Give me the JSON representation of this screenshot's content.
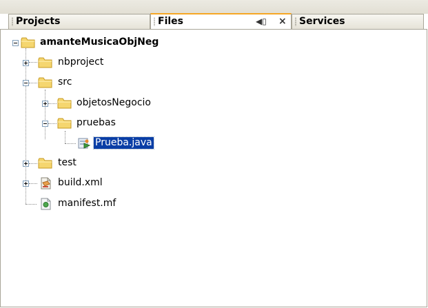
{
  "tabs": [
    {
      "label": "Projects",
      "active": false
    },
    {
      "label": "Files",
      "active": true
    },
    {
      "label": "Services",
      "active": false
    }
  ],
  "tab_controls": {
    "minimize_glyph": "◀▯",
    "close_glyph": "×"
  },
  "tree": {
    "root": {
      "label": "amanteMusicaObjNeg",
      "icon": "folder-icon",
      "expanded": true
    },
    "items": [
      {
        "label": "nbproject",
        "icon": "folder-icon",
        "expanded": false
      },
      {
        "label": "src",
        "icon": "folder-icon",
        "expanded": true
      },
      {
        "label": "objetosNegocio",
        "icon": "folder-icon",
        "expanded": false
      },
      {
        "label": "pruebas",
        "icon": "folder-icon",
        "expanded": true
      },
      {
        "label": "Prueba.java",
        "icon": "java-file-icon",
        "selected": true
      },
      {
        "label": "test",
        "icon": "folder-icon",
        "expanded": false
      },
      {
        "label": "build.xml",
        "icon": "ant-build-file-icon",
        "expanded": false
      },
      {
        "label": "manifest.mf",
        "icon": "manifest-file-icon"
      }
    ]
  },
  "colors": {
    "active_tab_accent": "#f6a623",
    "selection": "#0a3ea6",
    "folder": "#f5d66f"
  }
}
